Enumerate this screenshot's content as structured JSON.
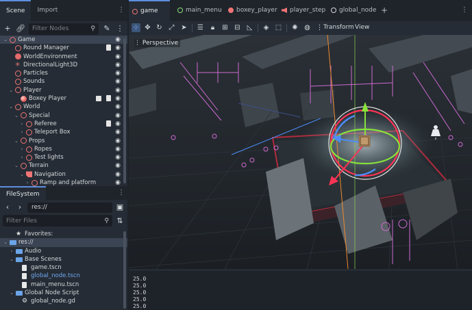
{
  "left_dock": {
    "tabs": [
      {
        "label": "Scene"
      },
      {
        "label": "Import"
      }
    ],
    "filter_nodes_placeholder": "Filter Nodes",
    "scene_tree": [
      {
        "label": "Game",
        "icon": "ring-icon",
        "arrow": "open"
      },
      {
        "label": "Round Manager",
        "icon": "ring-icon",
        "script": true
      },
      {
        "label": "WorldEnvironment",
        "icon": "globe-icon"
      },
      {
        "label": "DirectionalLight3D",
        "icon": "sun-icon"
      },
      {
        "label": "Particles",
        "icon": "ring-icon"
      },
      {
        "label": "Sounds",
        "icon": "ring-icon"
      },
      {
        "label": "Player",
        "icon": "ring-icon",
        "arrow": "open"
      },
      {
        "label": "Boxey Player",
        "icon": "ball-icon",
        "clapboard": true,
        "script": true
      },
      {
        "label": "World",
        "icon": "ring-icon",
        "arrow": "open"
      },
      {
        "label": "Special",
        "icon": "ring-icon",
        "arrow": "open"
      },
      {
        "label": "Referee",
        "icon": "ring-icon",
        "arrow": "closed",
        "script": true
      },
      {
        "label": "Teleport Box",
        "icon": "ring-icon",
        "arrow": "closed"
      },
      {
        "label": "Props",
        "icon": "ring-icon",
        "arrow": "open"
      },
      {
        "label": "Ropes",
        "icon": "ring-icon",
        "arrow": "closed"
      },
      {
        "label": "Test lights",
        "icon": "ring-icon",
        "arrow": "closed"
      },
      {
        "label": "Terrain",
        "icon": "ring-icon",
        "arrow": "open"
      },
      {
        "label": "Navigation",
        "icon": "navigation-icon",
        "arrow": "open"
      },
      {
        "label": "Ramp and platform",
        "icon": "ring-icon",
        "arrow": "closed"
      }
    ],
    "filesystem": {
      "tab_label": "FileSystem",
      "path": "res://",
      "filter_placeholder": "Filter Files",
      "items": [
        {
          "label": "Favorites:",
          "kind": "star"
        },
        {
          "label": "res://",
          "kind": "folder",
          "arrow": "open"
        },
        {
          "label": "Audio",
          "kind": "folder",
          "arrow": "closed"
        },
        {
          "label": "Base Scenes",
          "kind": "folder",
          "arrow": "open"
        },
        {
          "label": "game.tscn",
          "kind": "scene"
        },
        {
          "label": "global_node.tscn",
          "kind": "scene",
          "highlight": true
        },
        {
          "label": "main_menu.tscn",
          "kind": "scene"
        },
        {
          "label": "Global Node Script",
          "kind": "folder",
          "arrow": "open"
        },
        {
          "label": "global_node.gd",
          "kind": "gear"
        }
      ]
    }
  },
  "editor_tabs": [
    {
      "label": "game",
      "icon": "ring-icon",
      "color": "#f07575"
    },
    {
      "label": "main_menu",
      "icon": "ring-icon",
      "color": "#8fe07a"
    },
    {
      "label": "boxey_player",
      "icon": "ball-icon",
      "color": "#f07575"
    },
    {
      "label": "player_step",
      "icon": "speaker-icon",
      "color": "#f07575"
    },
    {
      "label": "global_node",
      "icon": "ring-icon",
      "color": "#d5d8dc"
    }
  ],
  "viewport_toolbar": {
    "transform_label": "Transform",
    "view_label": "View"
  },
  "viewport": {
    "perspective_label": "Perspective"
  },
  "output": {
    "lines": [
      "25.0",
      "25.0",
      "25.0",
      "25.0",
      "25.0"
    ]
  },
  "colors": {
    "accent": "#5d8fe0",
    "node3d": "#f07575",
    "gizmo_x": "#ff3355",
    "gizmo_y": "#88e33a",
    "gizmo_z": "#4c8df7",
    "nav_mesh": "#d66bd6"
  }
}
